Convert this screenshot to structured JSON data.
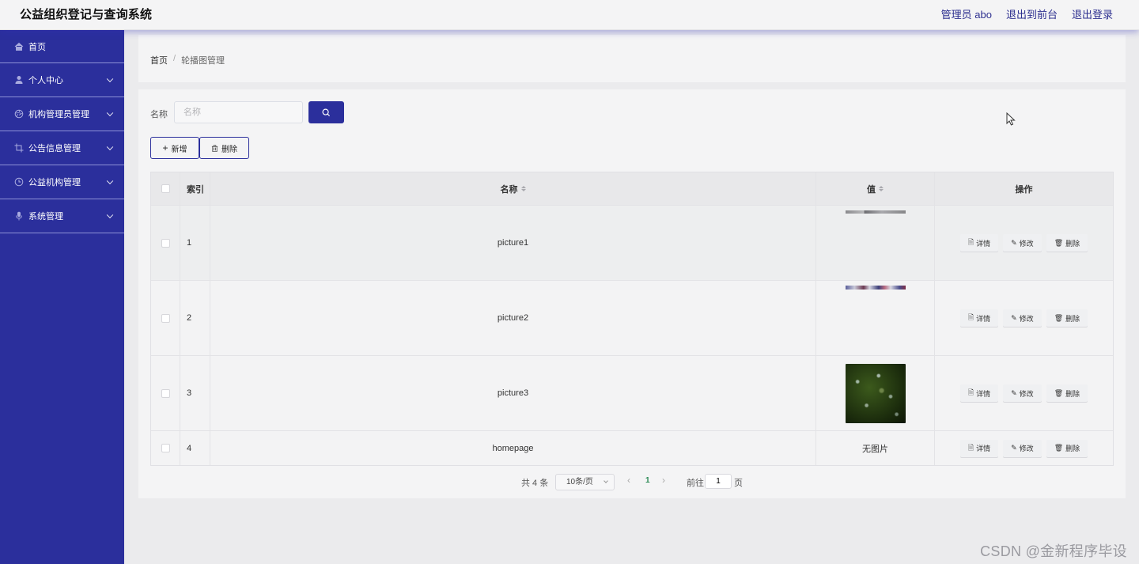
{
  "header": {
    "title": "公益组织登记与查询系统",
    "links": [
      "管理员 abo",
      "退出到前台",
      "退出登录"
    ]
  },
  "sidebar": {
    "items": [
      {
        "label": "首页",
        "icon": "home-icon",
        "has_arrow": false
      },
      {
        "label": "个人中心",
        "icon": "user-icon",
        "has_arrow": true
      },
      {
        "label": "机构管理员管理",
        "icon": "aperture-icon",
        "has_arrow": true
      },
      {
        "label": "公告信息管理",
        "icon": "crop-icon",
        "has_arrow": true
      },
      {
        "label": "公益机构管理",
        "icon": "clock-icon",
        "has_arrow": true
      },
      {
        "label": "系统管理",
        "icon": "microphone-icon",
        "has_arrow": true
      }
    ]
  },
  "breadcrumb": {
    "home": "首页",
    "separator": "/",
    "current": "轮播图管理"
  },
  "search": {
    "label": "名称",
    "placeholder": "名称",
    "value": ""
  },
  "toolbar": {
    "add_label": "新增",
    "delete_label": "删除"
  },
  "table": {
    "columns": [
      "索引",
      "名称",
      "值",
      "操作"
    ],
    "rows": [
      {
        "index": "1",
        "name": "picture1",
        "value_type": "image-strip"
      },
      {
        "index": "2",
        "name": "picture2",
        "value_type": "image-strip"
      },
      {
        "index": "3",
        "name": "picture3",
        "value_type": "image"
      },
      {
        "index": "4",
        "name": "homepage",
        "value_type": "text",
        "value_text": "无图片"
      }
    ],
    "actions": [
      "详情",
      "修改",
      "删除"
    ]
  },
  "pagination": {
    "total_text": "共 4 条",
    "page_size": "10条/页",
    "current_page": "1",
    "goto_label": "前往",
    "goto_value": "1",
    "page_suffix": "页"
  },
  "watermark": "CSDN @金新程序毕设",
  "colors": {
    "accent": "#2b2f9c",
    "sidebar_bg": "#2b2f9c",
    "current_page": "#2b8a55"
  }
}
